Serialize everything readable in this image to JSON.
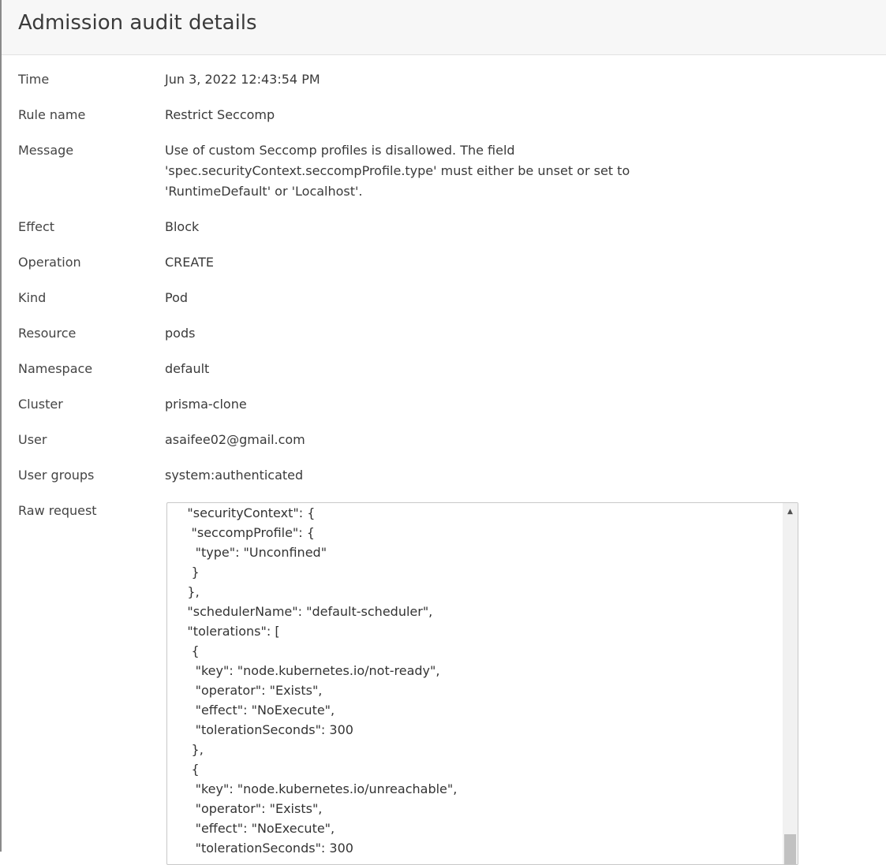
{
  "modal": {
    "title": "Admission audit details"
  },
  "fields": [
    {
      "label": "Time",
      "value": "Jun 3, 2022 12:43:54 PM"
    },
    {
      "label": "Rule name",
      "value": "Restrict Seccomp"
    },
    {
      "label": "Message",
      "value": "Use of custom Seccomp profiles is disallowed. The field 'spec.securityContext.seccompProfile.type' must either be unset or set to 'RuntimeDefault' or 'Localhost'."
    },
    {
      "label": "Effect",
      "value": "Block"
    },
    {
      "label": "Operation",
      "value": "CREATE"
    },
    {
      "label": "Kind",
      "value": "Pod"
    },
    {
      "label": "Resource",
      "value": "pods"
    },
    {
      "label": "Namespace",
      "value": "default"
    },
    {
      "label": "Cluster",
      "value": "prisma-clone"
    },
    {
      "label": "User",
      "value": "asaifee02@gmail.com"
    },
    {
      "label": "User groups",
      "value": "system:authenticated"
    },
    {
      "label": "Raw request",
      "value": ""
    }
  ],
  "raw_request": {
    "lines": [
      "     \"securityContext\": {",
      "      \"seccompProfile\": {",
      "       \"type\": \"Unconfined\"",
      "      }",
      "     },",
      "     \"schedulerName\": \"default-scheduler\",",
      "     \"tolerations\": [",
      "      {",
      "       \"key\": \"node.kubernetes.io/not-ready\",",
      "       \"operator\": \"Exists\",",
      "       \"effect\": \"NoExecute\",",
      "       \"tolerationSeconds\": 300",
      "      },",
      "      {",
      "       \"key\": \"node.kubernetes.io/unreachable\",",
      "       \"operator\": \"Exists\",",
      "       \"effect\": \"NoExecute\",",
      "       \"tolerationSeconds\": 300"
    ],
    "scroll_up_icon": "triangle-up-icon"
  }
}
